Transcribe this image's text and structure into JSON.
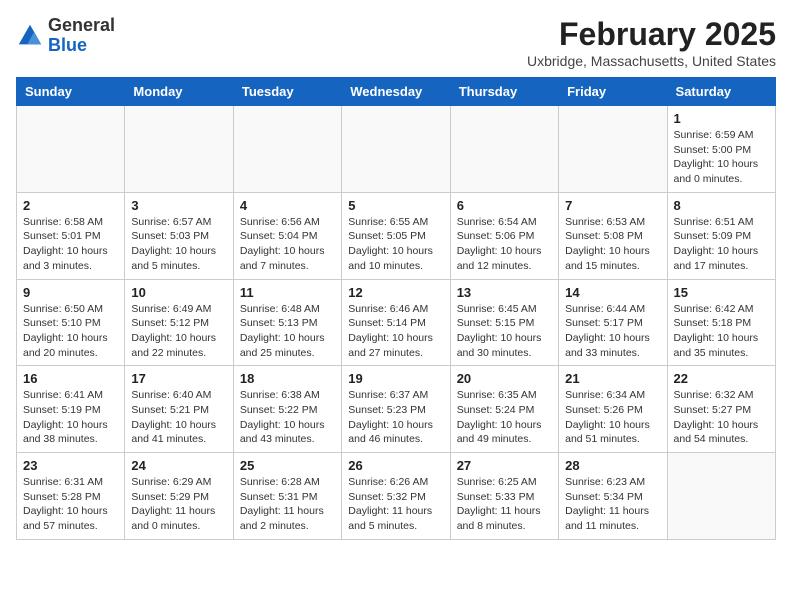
{
  "header": {
    "logo_line1": "General",
    "logo_line2": "Blue",
    "month_title": "February 2025",
    "location": "Uxbridge, Massachusetts, United States"
  },
  "days_of_week": [
    "Sunday",
    "Monday",
    "Tuesday",
    "Wednesday",
    "Thursday",
    "Friday",
    "Saturday"
  ],
  "weeks": [
    [
      {
        "day": "",
        "info": ""
      },
      {
        "day": "",
        "info": ""
      },
      {
        "day": "",
        "info": ""
      },
      {
        "day": "",
        "info": ""
      },
      {
        "day": "",
        "info": ""
      },
      {
        "day": "",
        "info": ""
      },
      {
        "day": "1",
        "info": "Sunrise: 6:59 AM\nSunset: 5:00 PM\nDaylight: 10 hours\nand 0 minutes."
      }
    ],
    [
      {
        "day": "2",
        "info": "Sunrise: 6:58 AM\nSunset: 5:01 PM\nDaylight: 10 hours\nand 3 minutes."
      },
      {
        "day": "3",
        "info": "Sunrise: 6:57 AM\nSunset: 5:03 PM\nDaylight: 10 hours\nand 5 minutes."
      },
      {
        "day": "4",
        "info": "Sunrise: 6:56 AM\nSunset: 5:04 PM\nDaylight: 10 hours\nand 7 minutes."
      },
      {
        "day": "5",
        "info": "Sunrise: 6:55 AM\nSunset: 5:05 PM\nDaylight: 10 hours\nand 10 minutes."
      },
      {
        "day": "6",
        "info": "Sunrise: 6:54 AM\nSunset: 5:06 PM\nDaylight: 10 hours\nand 12 minutes."
      },
      {
        "day": "7",
        "info": "Sunrise: 6:53 AM\nSunset: 5:08 PM\nDaylight: 10 hours\nand 15 minutes."
      },
      {
        "day": "8",
        "info": "Sunrise: 6:51 AM\nSunset: 5:09 PM\nDaylight: 10 hours\nand 17 minutes."
      }
    ],
    [
      {
        "day": "9",
        "info": "Sunrise: 6:50 AM\nSunset: 5:10 PM\nDaylight: 10 hours\nand 20 minutes."
      },
      {
        "day": "10",
        "info": "Sunrise: 6:49 AM\nSunset: 5:12 PM\nDaylight: 10 hours\nand 22 minutes."
      },
      {
        "day": "11",
        "info": "Sunrise: 6:48 AM\nSunset: 5:13 PM\nDaylight: 10 hours\nand 25 minutes."
      },
      {
        "day": "12",
        "info": "Sunrise: 6:46 AM\nSunset: 5:14 PM\nDaylight: 10 hours\nand 27 minutes."
      },
      {
        "day": "13",
        "info": "Sunrise: 6:45 AM\nSunset: 5:15 PM\nDaylight: 10 hours\nand 30 minutes."
      },
      {
        "day": "14",
        "info": "Sunrise: 6:44 AM\nSunset: 5:17 PM\nDaylight: 10 hours\nand 33 minutes."
      },
      {
        "day": "15",
        "info": "Sunrise: 6:42 AM\nSunset: 5:18 PM\nDaylight: 10 hours\nand 35 minutes."
      }
    ],
    [
      {
        "day": "16",
        "info": "Sunrise: 6:41 AM\nSunset: 5:19 PM\nDaylight: 10 hours\nand 38 minutes."
      },
      {
        "day": "17",
        "info": "Sunrise: 6:40 AM\nSunset: 5:21 PM\nDaylight: 10 hours\nand 41 minutes."
      },
      {
        "day": "18",
        "info": "Sunrise: 6:38 AM\nSunset: 5:22 PM\nDaylight: 10 hours\nand 43 minutes."
      },
      {
        "day": "19",
        "info": "Sunrise: 6:37 AM\nSunset: 5:23 PM\nDaylight: 10 hours\nand 46 minutes."
      },
      {
        "day": "20",
        "info": "Sunrise: 6:35 AM\nSunset: 5:24 PM\nDaylight: 10 hours\nand 49 minutes."
      },
      {
        "day": "21",
        "info": "Sunrise: 6:34 AM\nSunset: 5:26 PM\nDaylight: 10 hours\nand 51 minutes."
      },
      {
        "day": "22",
        "info": "Sunrise: 6:32 AM\nSunset: 5:27 PM\nDaylight: 10 hours\nand 54 minutes."
      }
    ],
    [
      {
        "day": "23",
        "info": "Sunrise: 6:31 AM\nSunset: 5:28 PM\nDaylight: 10 hours\nand 57 minutes."
      },
      {
        "day": "24",
        "info": "Sunrise: 6:29 AM\nSunset: 5:29 PM\nDaylight: 11 hours\nand 0 minutes."
      },
      {
        "day": "25",
        "info": "Sunrise: 6:28 AM\nSunset: 5:31 PM\nDaylight: 11 hours\nand 2 minutes."
      },
      {
        "day": "26",
        "info": "Sunrise: 6:26 AM\nSunset: 5:32 PM\nDaylight: 11 hours\nand 5 minutes."
      },
      {
        "day": "27",
        "info": "Sunrise: 6:25 AM\nSunset: 5:33 PM\nDaylight: 11 hours\nand 8 minutes."
      },
      {
        "day": "28",
        "info": "Sunrise: 6:23 AM\nSunset: 5:34 PM\nDaylight: 11 hours\nand 11 minutes."
      },
      {
        "day": "",
        "info": ""
      }
    ]
  ]
}
